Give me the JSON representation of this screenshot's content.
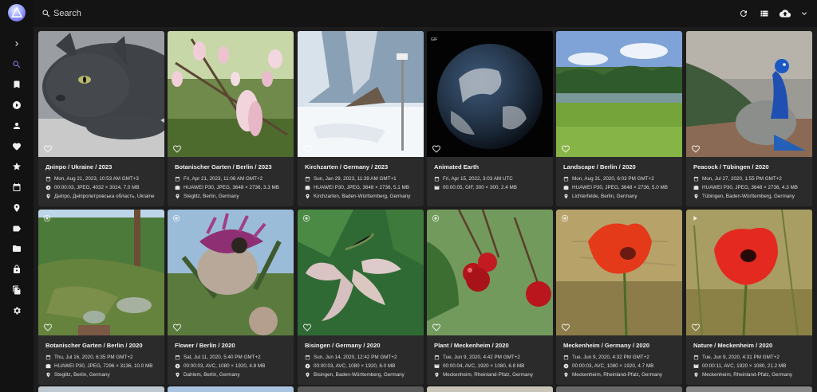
{
  "search": {
    "placeholder": "Search"
  },
  "sidebar": {
    "items": [
      {
        "name": "expand-icon"
      },
      {
        "name": "search-icon"
      },
      {
        "name": "bookmark-icon"
      },
      {
        "name": "play-circle-icon"
      },
      {
        "name": "person-icon"
      },
      {
        "name": "heart-icon"
      },
      {
        "name": "star-icon"
      },
      {
        "name": "calendar-icon"
      },
      {
        "name": "map-pin-icon"
      },
      {
        "name": "label-icon"
      },
      {
        "name": "folder-icon"
      },
      {
        "name": "lock-icon"
      },
      {
        "name": "file-copy-icon"
      },
      {
        "name": "settings-icon"
      }
    ]
  },
  "toolbar": {
    "icons": [
      "refresh-icon",
      "view-list-icon",
      "upload-icon",
      "chevron-down-icon"
    ]
  },
  "photos": [
    {
      "title": "Дніпро / Ukraine / 2023",
      "date": "Mon, Aug 21, 2023, 10:53 AM GMT+3",
      "meta": "00:00:03, JPEG, 4032 × 3024, 7.0 MB",
      "meta_icon": "play-circle-icon",
      "location": "Дніпро, Дніпропетровська область, Ukraine"
    },
    {
      "title": "Botanischer Garten / Berlin / 2023",
      "date": "Fri, Apr 21, 2023, 11:08 AM GMT+2",
      "meta": "HUAWEI P30, JPEG, 3648 × 2736, 3.3 MB",
      "meta_icon": "camera-icon",
      "location": "Steglitz, Berlin, Germany"
    },
    {
      "title": "Kirchzarten / Germany / 2023",
      "date": "Sun, Jan 29, 2023, 11:39 AM GMT+1",
      "meta": "HUAWEI P30, JPEG, 3648 × 2736, 5.1 MB",
      "meta_icon": "camera-icon",
      "location": "Kirchzarten, Baden-Württemberg, Germany"
    },
    {
      "title": "Animated Earth",
      "date": "Fri, Apr 15, 2022, 3:03 AM UTC",
      "meta": "00:00:05, GIF, 300 × 300, 2.4 MB",
      "meta_icon": "film-icon",
      "location": ""
    },
    {
      "title": "Landscape / Berlin / 2020",
      "date": "Mon, Aug 31, 2020, 6:03 PM GMT+2",
      "meta": "HUAWEI P30, JPEG, 3648 × 2736, 5.0 MB",
      "meta_icon": "camera-icon",
      "location": "Lichterfelde, Berlin, Germany"
    },
    {
      "title": "Peacock / Tübingen / 2020",
      "date": "Mon, Jul 27, 2020, 1:55 PM GMT+2",
      "meta": "HUAWEI P30, JPEG, 3648 × 2736, 4.3 MB",
      "meta_icon": "camera-icon",
      "location": "Tübingen, Baden-Württemberg, Germany"
    },
    {
      "title": "Botanischer Garten / Berlin / 2020",
      "date": "Thu, Jul 16, 2020, 6:35 PM GMT+2",
      "meta": "HUAWEI P30, JPEG, 7296 × 3136, 10.0 MB",
      "meta_icon": "camera-icon",
      "location": "Steglitz, Berlin, Germany"
    },
    {
      "title": "Flower / Berlin / 2020",
      "date": "Sat, Jul 11, 2020, 5:40 PM GMT+2",
      "meta": "00:00:03, AVC, 1080 × 1920, 4.8 MB",
      "meta_icon": "play-circle-icon",
      "location": "Dahlem, Berlin, Germany"
    },
    {
      "title": "Bisingen / Germany / 2020",
      "date": "Sun, Jun 14, 2020, 12:42 PM GMT+2",
      "meta": "00:00:03, AVC, 1080 × 1920, 6.0 MB",
      "meta_icon": "play-circle-icon",
      "location": "Bisingen, Baden-Württemberg, Germany"
    },
    {
      "title": "Plant / Meckenheim / 2020",
      "date": "Tue, Jun 9, 2020, 4:42 PM GMT+2",
      "meta": "00:00:04, AVC, 1920 × 1080, 6.8 MB",
      "meta_icon": "film-icon",
      "location": "Meckenheim, Rheinland-Pfalz, Germany"
    },
    {
      "title": "Meckenheim / Germany / 2020",
      "date": "Tue, Jun 9, 2020, 4:32 PM GMT+2",
      "meta": "00:00:03, AVC, 1080 × 1920, 4.7 MB",
      "meta_icon": "play-circle-icon",
      "location": "Meckenheim, Rheinland-Pfalz, Germany"
    },
    {
      "title": "Nature / Meckenheim / 2020",
      "date": "Tue, Jun 9, 2020, 4:31 PM GMT+2",
      "meta": "00:00:11, AVC, 1920 × 1080, 21.2 MB",
      "meta_icon": "film-icon",
      "location": "Meckenheim, Rheinland-Pfalz, Germany"
    }
  ]
}
